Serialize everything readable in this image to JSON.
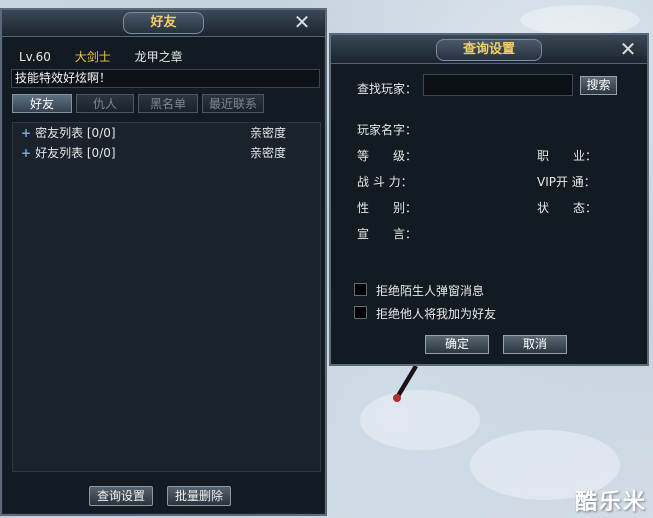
{
  "friends_window": {
    "title": "好友",
    "level": "Lv.60",
    "class_name": "大剑士",
    "guild": "龙甲之章",
    "signature": "技能特效好炫啊！",
    "tabs": [
      "好友",
      "仇人",
      "黑名单",
      "最近联系"
    ],
    "active_tab": "好友",
    "groups": [
      {
        "label": "密友列表 [0/0]",
        "intimacy_header": "亲密度"
      },
      {
        "label": "好友列表 [0/0]",
        "intimacy_header": "亲密度"
      }
    ],
    "query_button": "查询设置",
    "batch_delete_button": "批量删除"
  },
  "query_dialog": {
    "title": "查询设置",
    "find_player_label": "查找玩家：",
    "search_value": "",
    "search_button": "搜索",
    "player_name_label": "玩家名字：",
    "level_label": "等　　级：",
    "power_label": "战 斗 力：",
    "gender_label": "性　　别：",
    "declaration_label": "宣　　言：",
    "job_label": "职　　业：",
    "vip_label": "VIP开 通：",
    "status_label": "状　　态：",
    "reject_stranger_popup": "拒绝陌生人弹窗消息",
    "reject_friend_add": "拒绝他人将我加为好友",
    "reject_stranger_checked": false,
    "reject_friend_checked": false,
    "confirm_button": "确定",
    "cancel_button": "取消"
  },
  "watermark": "酷乐米",
  "colors": {
    "accent_gold": "#f3cf6a",
    "class_gold": "#f0c63a",
    "panel_bg": "#121a22"
  }
}
